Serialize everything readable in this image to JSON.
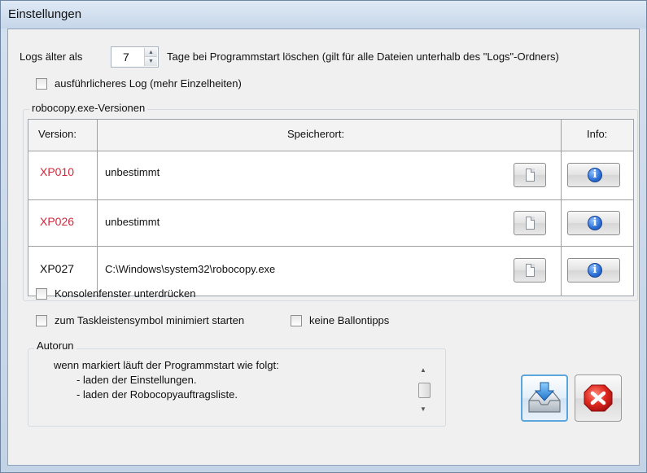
{
  "window": {
    "title": "Einstellungen"
  },
  "logs": {
    "prefix": "Logs älter als",
    "days_value": "7",
    "suffix": "Tage bei Programmstart löschen (gilt für alle Dateien unterhalb des \"Logs\"-Ordners)",
    "verbose_label": "ausführlicheres Log (mehr Einzelheiten)",
    "verbose_checked": false
  },
  "versions_group": {
    "title": "robocopy.exe-Versionen",
    "columns": {
      "version": "Version:",
      "location": "Speicherort:",
      "info": "Info:"
    },
    "rows": [
      {
        "version": "XP010",
        "location": "unbestimmt",
        "status": "missing"
      },
      {
        "version": "XP026",
        "location": "unbestimmt",
        "status": "missing"
      },
      {
        "version": "XP027",
        "location": "C:\\Windows\\system32\\robocopy.exe",
        "status": "found"
      }
    ]
  },
  "options": {
    "suppress_console": "Konsolenfenster unterdrücken",
    "start_minimized": "zum Taskleistensymbol minimiert starten",
    "no_balloon": "keine Ballontipps"
  },
  "autorun": {
    "title": "Autorun",
    "line1": "wenn markiert läuft der Programmstart wie folgt:",
    "line2": "- laden der Einstellungen.",
    "line3": "- laden der Robocopyauftragsliste.",
    "checked": false
  },
  "colors": {
    "missing_version": "#d1283c",
    "accent": "#2b6fd6",
    "cancel": "#d42222"
  },
  "icons": {
    "spin_up": "triangle-up",
    "spin_down": "triangle-down",
    "browse": "document-icon",
    "info": "info-icon",
    "save": "save-tray-icon",
    "cancel": "close-icon"
  }
}
